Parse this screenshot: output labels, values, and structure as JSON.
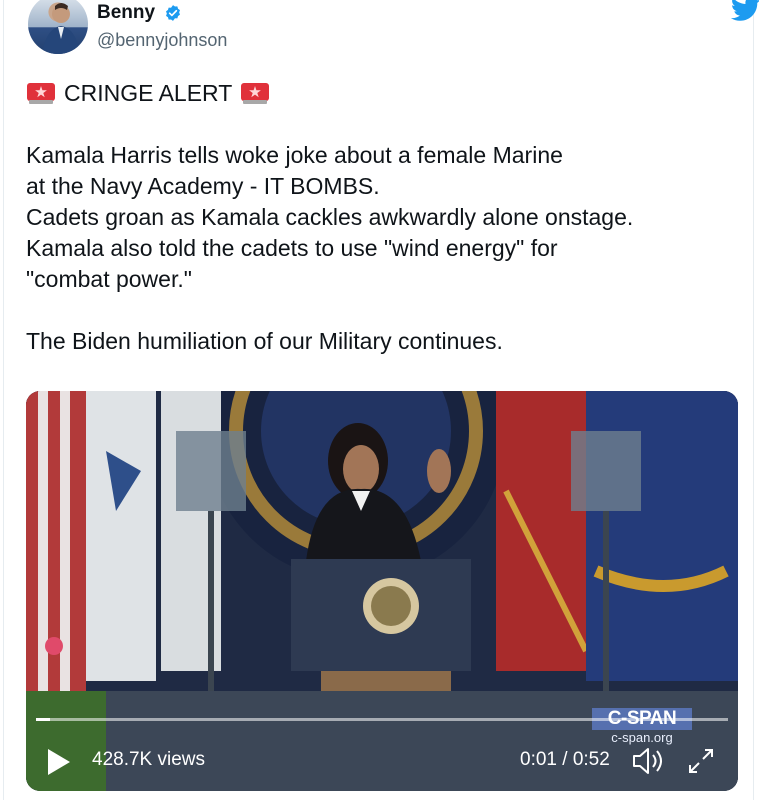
{
  "user": {
    "display_name": "Benny",
    "handle": "@bennyjohnson",
    "verified": true
  },
  "icons": {
    "verified": "verified-badge-icon",
    "brand": "twitter-bird-icon",
    "alert": "police-siren-icon",
    "play": "play-icon",
    "volume": "volume-icon",
    "fullscreen": "fullscreen-icon"
  },
  "tweet": {
    "alert_text": "CRINGE ALERT",
    "line1": "Kamala Harris tells woke joke about a female Marine",
    "line2": "at the Navy Academy - IT BOMBS.",
    "line3": "Cadets groan as Kamala cackles awkwardly alone onstage.",
    "line4": "Kamala also told the cadets to use \"wind energy\" for",
    "line5": "\"combat power.\"",
    "line6": "The Biden humiliation of our Military continues."
  },
  "video": {
    "views": "428.7K views",
    "time": "0:01 / 0:52",
    "progress": 0.02,
    "watermark_title": "C-SPAN",
    "watermark_url": "c-span.org"
  },
  "colors": {
    "brand_blue": "#1d9bf0",
    "text": "#0f1419",
    "secondary": "#536471",
    "siren_red": "#e0313b"
  }
}
